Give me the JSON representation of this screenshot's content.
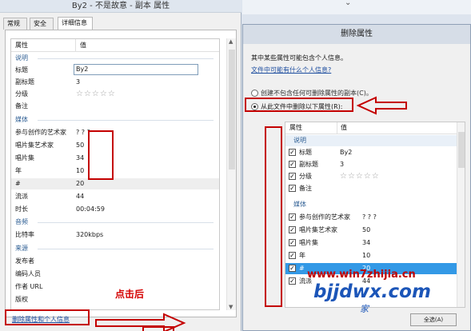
{
  "left_window": {
    "title": "By2 - 不是故意 - 副本 属性",
    "tabs": [
      "常规",
      "安全",
      "详细信息"
    ],
    "columns": [
      "属性",
      "值"
    ],
    "sections": {
      "description": "说明",
      "media": "媒体",
      "audio": "音频",
      "origin": "来源"
    },
    "rows": {
      "title": {
        "k": "标题",
        "v": "By2"
      },
      "subtitle": {
        "k": "副标题",
        "v": "3"
      },
      "rating": {
        "k": "分级",
        "stars": "☆☆☆☆☆"
      },
      "comment": {
        "k": "备注",
        "v": ""
      },
      "contrib": {
        "k": "参与创作的艺术家",
        "v": "? ? ?"
      },
      "album_artist": {
        "k": "唱片集艺术家",
        "v": "50"
      },
      "album": {
        "k": "唱片集",
        "v": "34"
      },
      "year": {
        "k": "年",
        "v": "10"
      },
      "track": {
        "k": "#",
        "v": "20"
      },
      "genre": {
        "k": "流派",
        "v": "44"
      },
      "length": {
        "k": "时长",
        "v": "00:04:59"
      },
      "bitrate": {
        "k": "比特率",
        "v": "320kbps"
      },
      "publisher": {
        "k": "发布者",
        "v": ""
      },
      "encoded_by": {
        "k": "编码人员",
        "v": ""
      },
      "author_url": {
        "k": "作者 URL",
        "v": ""
      },
      "cutoff": {
        "k": "版权",
        "v": ""
      }
    },
    "remove_link": "删除属性和个人信息",
    "annotation": "点击后"
  },
  "right_dialog": {
    "title": "删除属性",
    "intro": "其中某些属性可能包含个人信息。",
    "info_link": "文件中可能有什么个人信息?",
    "option1": "创建不包含任何可删除属性的副本(C)。",
    "option2": "从此文件中删除以下属性(R):",
    "columns": [
      "属性",
      "值"
    ],
    "section_desc": "说明",
    "section_media": "媒体",
    "rows": {
      "title": {
        "k": "标题",
        "v": "By2"
      },
      "subtitle": {
        "k": "副标题",
        "v": "3"
      },
      "rating": {
        "k": "分级",
        "stars": "☆☆☆☆☆"
      },
      "comment": {
        "k": "备注",
        "v": ""
      },
      "contrib": {
        "k": "参与创作的艺术家",
        "v": "? ? ?"
      },
      "album_artist": {
        "k": "唱片集艺术家",
        "v": "50"
      },
      "album": {
        "k": "唱片集",
        "v": "34"
      },
      "year": {
        "k": "年",
        "v": "10"
      },
      "track": {
        "k": "#",
        "v": "20"
      },
      "genre": {
        "k": "流派",
        "v": "44"
      }
    },
    "check_mark": "✓",
    "select_all": "全选(A)"
  },
  "watermark": {
    "line1": "www.win7zhijia.cn",
    "line2": "bjjdwx.com",
    "line3": "家"
  },
  "colors": {
    "annotation_red": "#c40000",
    "link_blue": "#1f4fa0",
    "selection_blue": "#3399e6"
  }
}
